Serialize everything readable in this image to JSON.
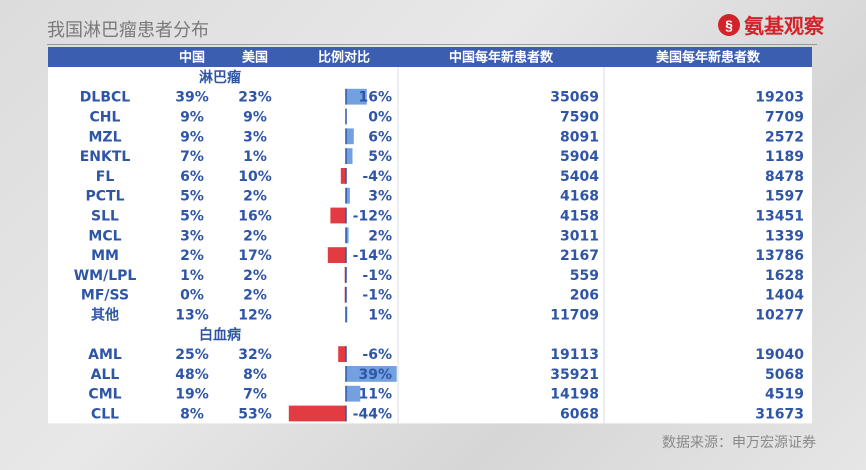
{
  "page_title": "我国淋巴瘤患者分布",
  "logo": {
    "mark": "§",
    "text": "氨基观察"
  },
  "source": "数据来源：申万宏源证券",
  "chart_data": {
    "type": "table",
    "columns": [
      "",
      "中国",
      "美国",
      "比例对比",
      "中国每年新患者数",
      "美国每年新患者数"
    ],
    "groups": [
      {
        "name": "淋巴瘤",
        "rows": [
          {
            "label": "DLBCL",
            "china": "39%",
            "usa": "23%",
            "diff": "16%",
            "diff_value": 16,
            "china_new": "35069",
            "usa_new": "19203"
          },
          {
            "label": "CHL",
            "china": "9%",
            "usa": "9%",
            "diff": "0%",
            "diff_value": 0,
            "china_new": "7590",
            "usa_new": "7709"
          },
          {
            "label": "MZL",
            "china": "9%",
            "usa": "3%",
            "diff": "6%",
            "diff_value": 6,
            "china_new": "8091",
            "usa_new": "2572"
          },
          {
            "label": "ENKTL",
            "china": "7%",
            "usa": "1%",
            "diff": "5%",
            "diff_value": 5,
            "china_new": "5904",
            "usa_new": "1189"
          },
          {
            "label": "FL",
            "china": "6%",
            "usa": "10%",
            "diff": "-4%",
            "diff_value": -4,
            "china_new": "5404",
            "usa_new": "8478"
          },
          {
            "label": "PCTL",
            "china": "5%",
            "usa": "2%",
            "diff": "3%",
            "diff_value": 3,
            "china_new": "4168",
            "usa_new": "1597"
          },
          {
            "label": "SLL",
            "china": "5%",
            "usa": "16%",
            "diff": "-12%",
            "diff_value": -12,
            "china_new": "4158",
            "usa_new": "13451"
          },
          {
            "label": "MCL",
            "china": "3%",
            "usa": "2%",
            "diff": "2%",
            "diff_value": 2,
            "china_new": "3011",
            "usa_new": "1339"
          },
          {
            "label": "MM",
            "china": "2%",
            "usa": "17%",
            "diff": "-14%",
            "diff_value": -14,
            "china_new": "2167",
            "usa_new": "13786"
          },
          {
            "label": "WM/LPL",
            "china": "1%",
            "usa": "2%",
            "diff": "-1%",
            "diff_value": -1,
            "china_new": "559",
            "usa_new": "1628"
          },
          {
            "label": "MF/SS",
            "china": "0%",
            "usa": "2%",
            "diff": "-1%",
            "diff_value": -1,
            "china_new": "206",
            "usa_new": "1404"
          },
          {
            "label": "其他",
            "china": "13%",
            "usa": "12%",
            "diff": "1%",
            "diff_value": 1,
            "china_new": "11709",
            "usa_new": "10277"
          }
        ]
      },
      {
        "name": "白血病",
        "rows": [
          {
            "label": "AML",
            "china": "25%",
            "usa": "32%",
            "diff": "-6%",
            "diff_value": -6,
            "china_new": "19113",
            "usa_new": "19040"
          },
          {
            "label": "ALL",
            "china": "48%",
            "usa": "8%",
            "diff": "39%",
            "diff_value": 39,
            "china_new": "35921",
            "usa_new": "5068"
          },
          {
            "label": "CML",
            "china": "19%",
            "usa": "7%",
            "diff": "11%",
            "diff_value": 11,
            "china_new": "14198",
            "usa_new": "4519"
          },
          {
            "label": "CLL",
            "china": "8%",
            "usa": "53%",
            "diff": "-44%",
            "diff_value": -44,
            "china_new": "6068",
            "usa_new": "31673"
          }
        ]
      }
    ],
    "colors": {
      "header_bg": "#3c5eb0",
      "header_text": "#ffffff",
      "cell_text": "#2e55a6",
      "positive_bar": "#5b8fd9",
      "negative_bar": "#e0262e"
    }
  }
}
